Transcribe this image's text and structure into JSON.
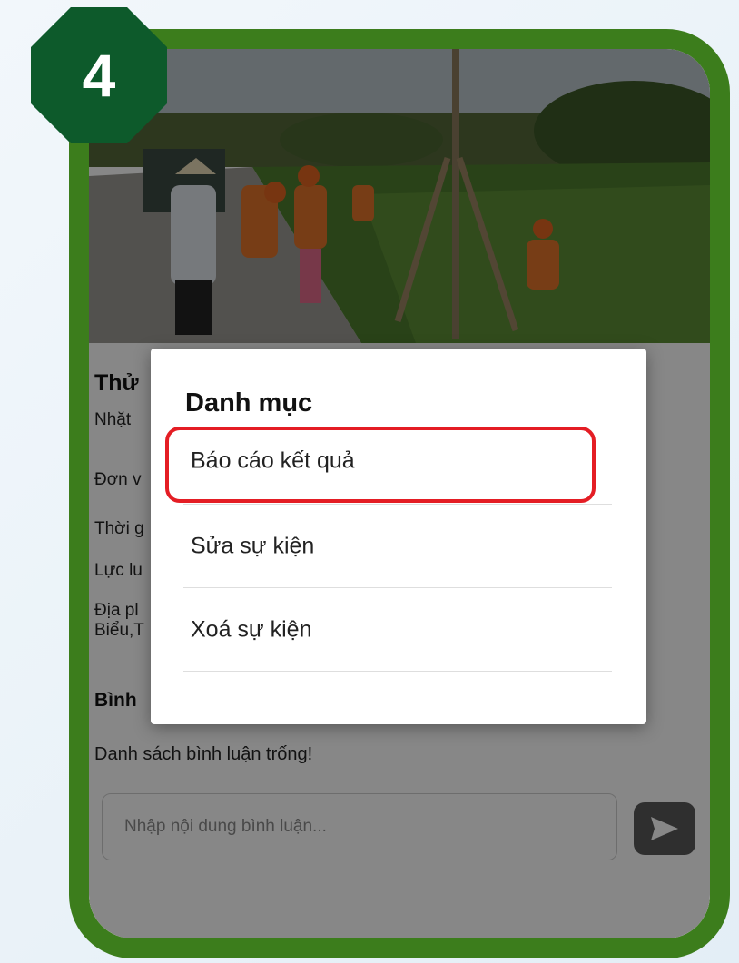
{
  "step_badge": "4",
  "event": {
    "title": "Thử",
    "details": [
      "Nhặt",
      "Đơn v",
      "Thời g",
      "Lực lu",
      "Địa pl",
      "Biểu,T"
    ]
  },
  "comments": {
    "header": "Bình",
    "empty_message": "Danh sách bình luận trống!",
    "input_placeholder": "Nhập nội dung bình luận...",
    "send_icon": "send-icon"
  },
  "dialog": {
    "title": "Danh mục",
    "items": [
      {
        "label": "Báo cáo kết quả",
        "highlighted": true
      },
      {
        "label": "Sửa sự kiện",
        "highlighted": false
      },
      {
        "label": "Xoá sự kiện",
        "highlighted": false
      }
    ]
  },
  "colors": {
    "frame": "#3c7d1c",
    "badge": "#0d5a2b",
    "highlight": "#e41d24",
    "send_button": "#5a5a5a"
  }
}
